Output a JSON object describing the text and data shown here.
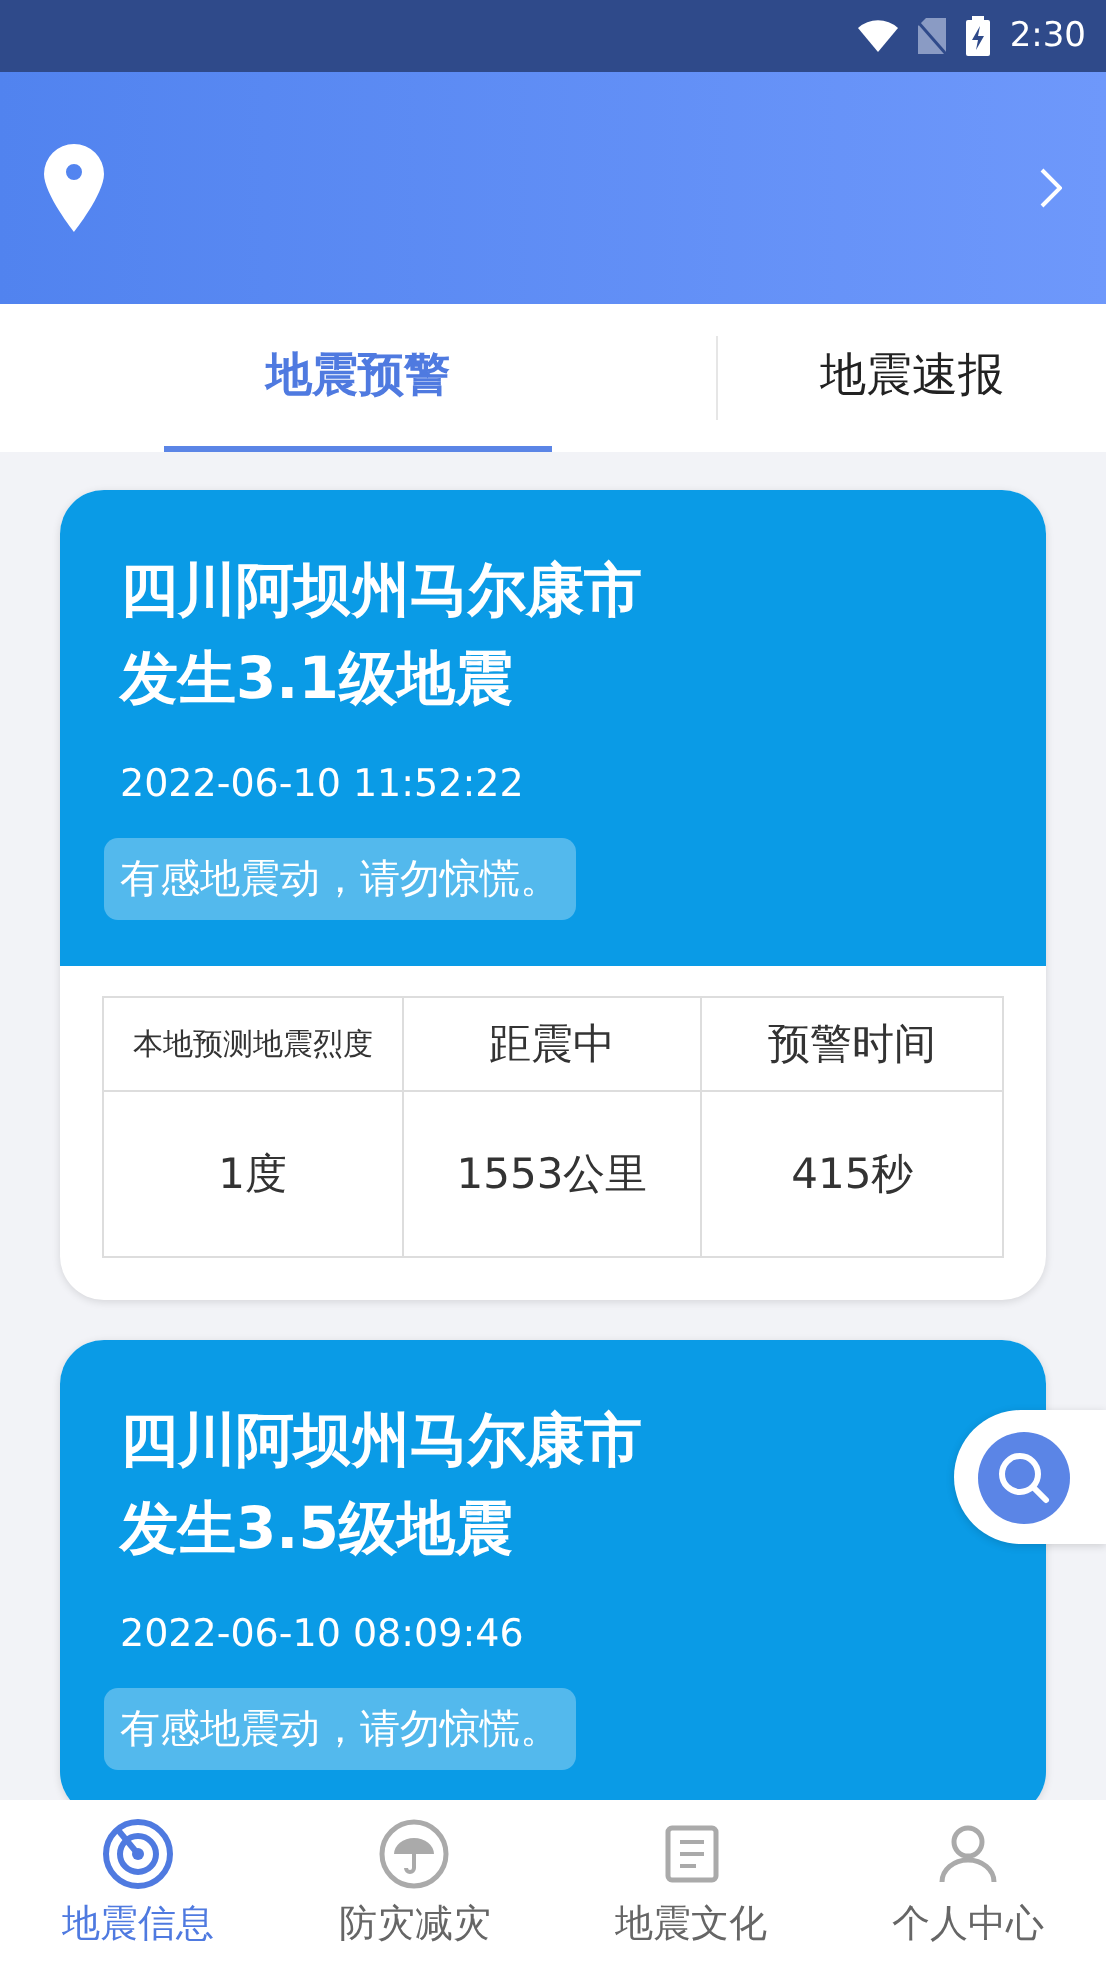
{
  "status_bar": {
    "time": "2:30"
  },
  "tabs": [
    {
      "label": "地震预警",
      "selected": true
    },
    {
      "label": "地震速报",
      "selected": false
    }
  ],
  "events": [
    {
      "title_lines": [
        "四川阿坝州马尔康市",
        "发生3.1级地震"
      ],
      "time": "2022-06-10 11:52:22",
      "notice": "有感地震动，请勿惊慌。",
      "stats": [
        {
          "label": "本地预测地震烈度",
          "value": "1度"
        },
        {
          "label": "距震中",
          "value": "1553公里"
        },
        {
          "label": "预警时间",
          "value": "415秒"
        }
      ]
    },
    {
      "title_lines": [
        "四川阿坝州马尔康市",
        "发生3.5级地震"
      ],
      "time": "2022-06-10 08:09:46",
      "notice": "有感地震动，请勿惊慌。"
    }
  ],
  "nav": [
    {
      "label": "地震信息",
      "kind": "radar",
      "selected": true
    },
    {
      "label": "防灾减灾",
      "kind": "umbrella",
      "selected": false
    },
    {
      "label": "地震文化",
      "kind": "book",
      "selected": false
    },
    {
      "label": "个人中心",
      "kind": "person",
      "selected": false
    }
  ]
}
